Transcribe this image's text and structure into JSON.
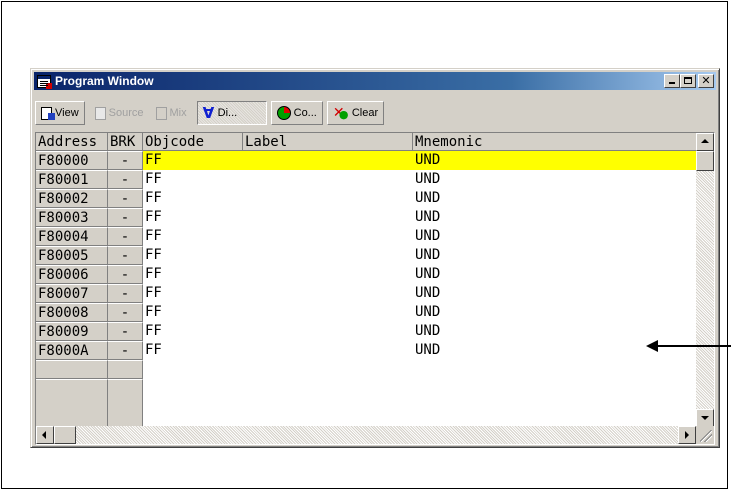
{
  "window": {
    "title": "Program Window"
  },
  "toolbar": {
    "view_label": "View",
    "source_label": "Source",
    "mix_label": "Mix",
    "disasm_label": "Di...",
    "coverage_label": "Co...",
    "clear_label": "Clear"
  },
  "table": {
    "headers": {
      "address": "Address",
      "brk": "BRK",
      "objcode": "Objcode",
      "label": "Label",
      "mnemonic": "Mnemonic"
    },
    "rows": [
      {
        "address": "F80000",
        "brk": "-",
        "objcode": "FF",
        "label": "",
        "mnemonic": "UND",
        "selected": true
      },
      {
        "address": "F80001",
        "brk": "-",
        "objcode": "FF",
        "label": "",
        "mnemonic": "UND"
      },
      {
        "address": "F80002",
        "brk": "-",
        "objcode": "FF",
        "label": "",
        "mnemonic": "UND"
      },
      {
        "address": "F80003",
        "brk": "-",
        "objcode": "FF",
        "label": "",
        "mnemonic": "UND"
      },
      {
        "address": "F80004",
        "brk": "-",
        "objcode": "FF",
        "label": "",
        "mnemonic": "UND"
      },
      {
        "address": "F80005",
        "brk": "-",
        "objcode": "FF",
        "label": "",
        "mnemonic": "UND"
      },
      {
        "address": "F80006",
        "brk": "-",
        "objcode": "FF",
        "label": "",
        "mnemonic": "UND"
      },
      {
        "address": "F80007",
        "brk": "-",
        "objcode": "FF",
        "label": "",
        "mnemonic": "UND"
      },
      {
        "address": "F80008",
        "brk": "-",
        "objcode": "FF",
        "label": "",
        "mnemonic": "UND"
      },
      {
        "address": "F80009",
        "brk": "-",
        "objcode": "FF",
        "label": "",
        "mnemonic": "UND"
      },
      {
        "address": "F8000A",
        "brk": "-",
        "objcode": "FF",
        "label": "",
        "mnemonic": "UND"
      }
    ]
  },
  "colors": {
    "selected_row": "#ffff00",
    "titlebar": "#0a246a"
  }
}
